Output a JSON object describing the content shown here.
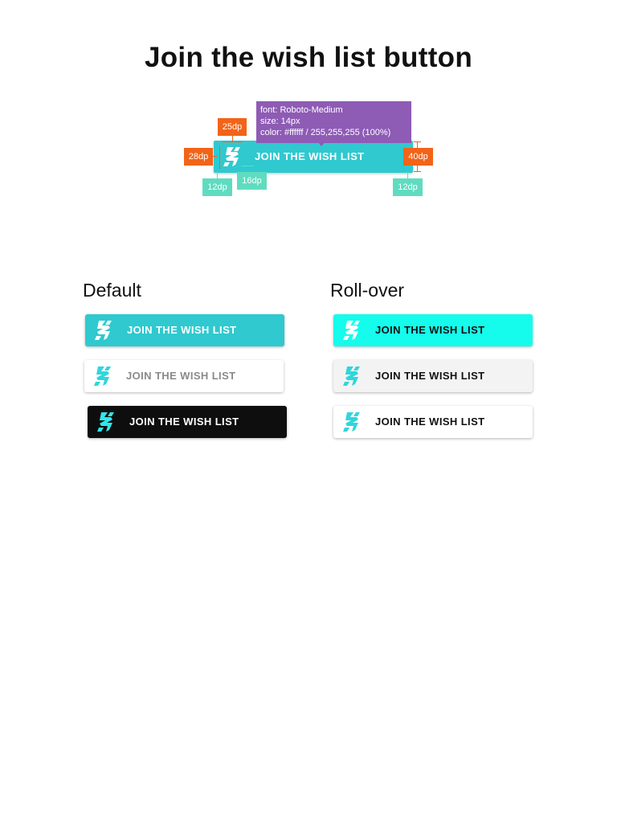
{
  "page": {
    "title": "Join the wish list button"
  },
  "spec": {
    "button_label": "JOIN THE WISH LIST",
    "tooltip": {
      "line1": "font: Roboto-Medium",
      "line2": "size: 14px",
      "line3": "color: #ffffff / 255,255,255 (100%)"
    },
    "measurements": {
      "icon_height": "25dp",
      "left_offset": "28dp",
      "button_height": "40dp",
      "left_padding": "12dp",
      "icon_gap": "16dp",
      "right_padding": "12dp"
    }
  },
  "sections": {
    "default_title": "Default",
    "rollover_title": "Roll-over"
  },
  "buttons": {
    "default": [
      {
        "label": "JOIN THE WISH LIST",
        "background": "#2fc9cf",
        "text_color": "#ffffff",
        "icon": "brand-s-icon-white"
      },
      {
        "label": "JOIN THE WISH LIST",
        "background": "#ffffff",
        "text_color": "#8a8a8a",
        "icon": "brand-s-icon-cyan"
      },
      {
        "label": "JOIN THE WISH LIST",
        "background": "#0e0e0e",
        "text_color": "#ffffff",
        "icon": "brand-s-icon-cyan"
      }
    ],
    "rollover": [
      {
        "label": "JOIN THE WISH LIST",
        "background": "#15fcec",
        "text_color": "#111111",
        "icon": "brand-s-icon-white"
      },
      {
        "label": "JOIN THE WISH LIST",
        "background": "#f3f3f3",
        "text_color": "#111111",
        "icon": "brand-s-icon-cyan"
      },
      {
        "label": "JOIN THE WISH LIST",
        "background": "#ffffff",
        "text_color": "#111111",
        "icon": "brand-s-icon-cyan"
      }
    ]
  },
  "colors": {
    "accent_cyan": "#2fc9cf",
    "measure_orange": "#f26418",
    "measure_green": "#5fdcc0",
    "tooltip_purple": "#8e5bb5"
  }
}
